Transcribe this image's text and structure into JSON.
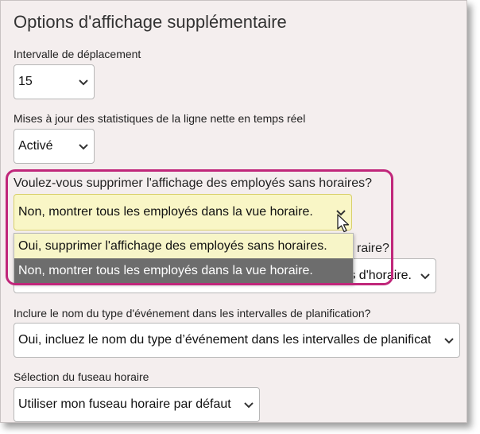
{
  "heading": "Options d'affichage supplémentaire",
  "move_interval": {
    "label": "Intervalle de déplacement",
    "value": "15"
  },
  "net_line_stats": {
    "label": "Mises à jour des statistiques de la ligne nette en temps réel",
    "value": "Activé"
  },
  "hide_unscheduled": {
    "label": "Voulez-vous supprimer l'affichage des employés sans horaires?",
    "value": "Non, montrer tous les employés dans la vue horaire.",
    "options": [
      "Oui, supprimer l'affichage des employés sans horaires.",
      "Non, montrer tous les employés dans la vue horaire."
    ],
    "highlighted_option_index": 1
  },
  "hidden_question": {
    "label_visible_fragment": "raire?",
    "value_visible_fragment": "ts d'horaire."
  },
  "event_type_name": {
    "label": "Inclure le nom du type d'événement dans les intervalles de planification?",
    "value": "Oui, incluez le nom du type d’événement dans les intervalles de planificat"
  },
  "timezone": {
    "label": "Sélection du fuseau horaire",
    "value": "Utiliser mon fuseau horaire par défaut"
  },
  "colors": {
    "panel_bg": "#f4eeee",
    "highlight_border": "#c0267a",
    "dropdown_bg": "#f7f5c8",
    "selected_option_bg": "#6d6d6d"
  },
  "icons": [
    "chevron-down-icon",
    "mouse-pointer-icon"
  ]
}
